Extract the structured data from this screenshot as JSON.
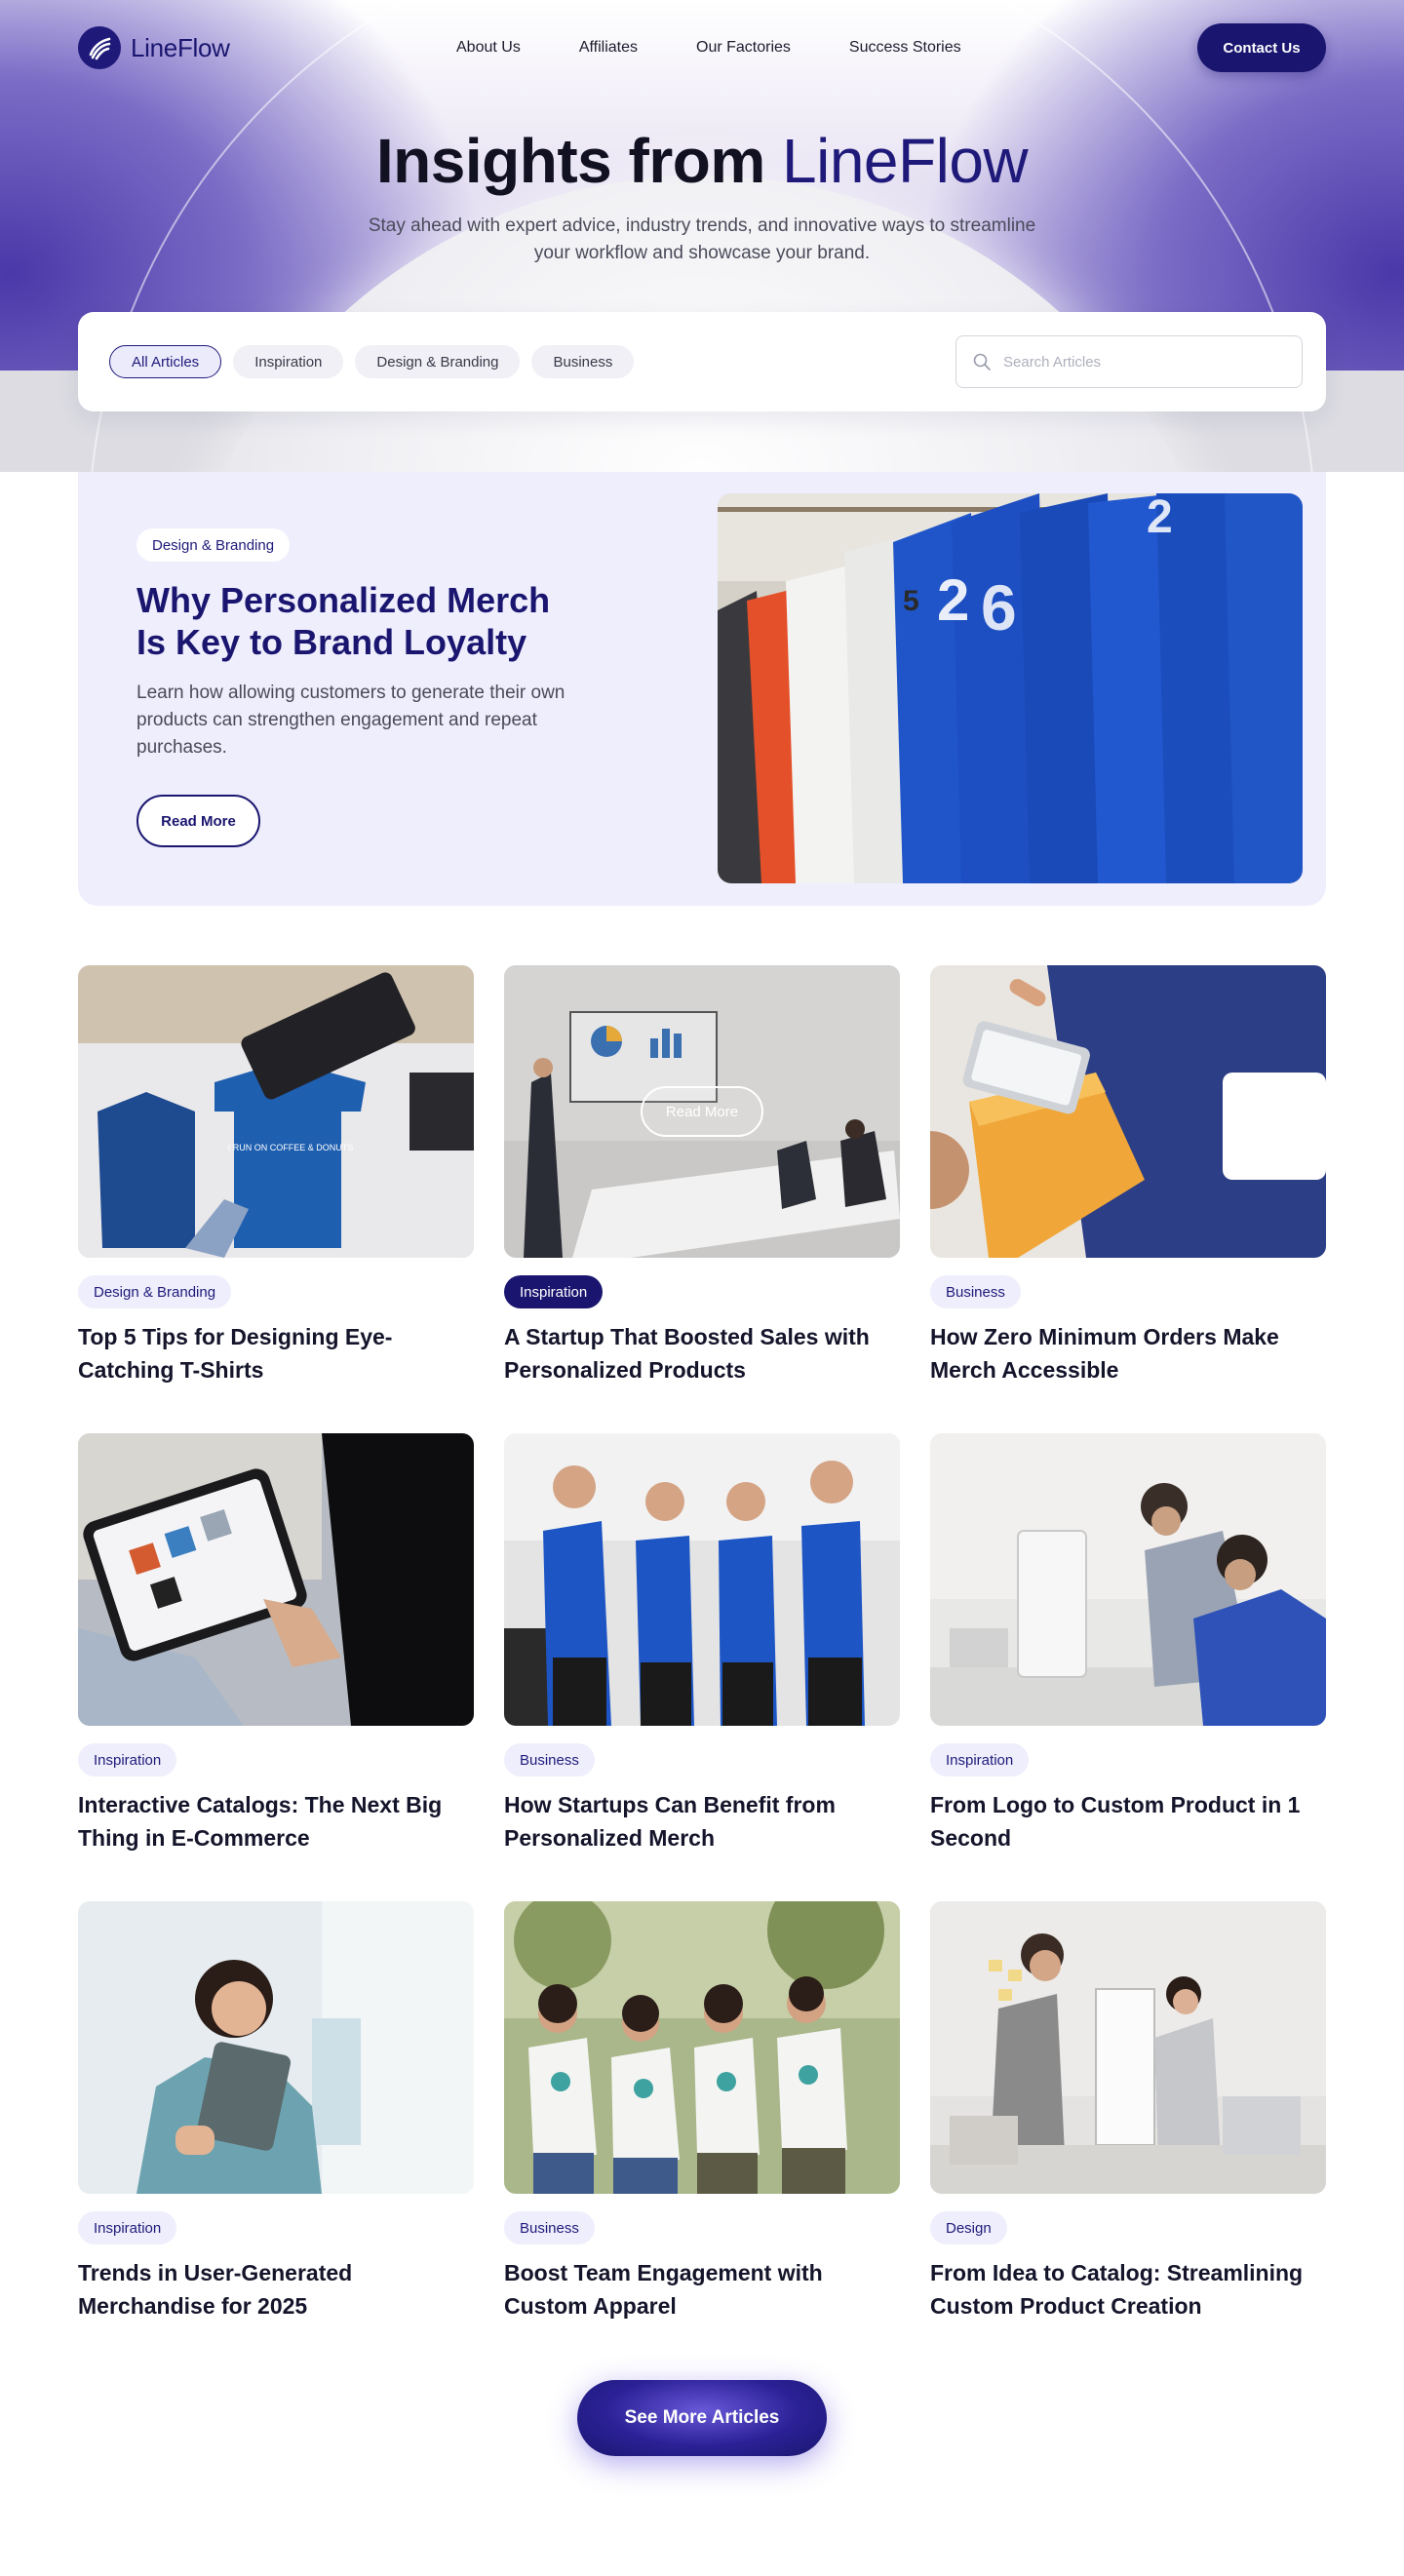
{
  "brand": {
    "name": "LineFlow",
    "primary": "#1a1670",
    "tint": "#efeefc"
  },
  "nav": {
    "links": [
      "About Us",
      "Affiliates",
      "Our Factories",
      "Success Stories"
    ],
    "cta": "Contact Us"
  },
  "hero": {
    "title_main": "Insights from",
    "title_accent": "LineFlow",
    "subtitle": "Stay ahead with expert advice, industry trends, and innovative ways to streamline your workflow and showcase your brand."
  },
  "filters": {
    "chips": [
      "All Articles",
      "Inspiration",
      "Design & Branding",
      "Business"
    ],
    "active": "All Articles",
    "search_placeholder": "Search Articles"
  },
  "featured": {
    "tag": "Design & Branding",
    "title": "Why Personalized Merch Is Key to Brand Loyalty",
    "description": "Learn how allowing customers to generate their own products can strengthen engagement and repeat purchases.",
    "button": "Read More",
    "image_icon": "jersey-rack-photo"
  },
  "articles": [
    {
      "tag": "Design & Branding",
      "title": "Top 5 Tips for Designing Eye-Catching T-Shirts",
      "image_text": "I RUN ON COFFEE & DONUTS"
    },
    {
      "tag": "Inspiration",
      "title": "A Startup That Boosted Sales with Personalized Products",
      "hover_label": "Read More"
    },
    {
      "tag": "Business",
      "title": "How Zero Minimum Orders Make Merch Accessible"
    },
    {
      "tag": "Inspiration",
      "title": "Interactive Catalogs: The Next Big Thing in E-Commerce"
    },
    {
      "tag": "Business",
      "title": "How Startups Can Benefit from Personalized Merch"
    },
    {
      "tag": "Inspiration",
      "title": "From Logo to Custom Product in 1 Second"
    },
    {
      "tag": "Inspiration",
      "title": "Trends in User-Generated Merchandise for 2025"
    },
    {
      "tag": "Business",
      "title": "Boost Team Engagement with Custom Apparel"
    },
    {
      "tag": "Design",
      "title": "From Idea to Catalog: Streamlining Custom Product Creation"
    }
  ],
  "footer_cta": "See More Articles"
}
